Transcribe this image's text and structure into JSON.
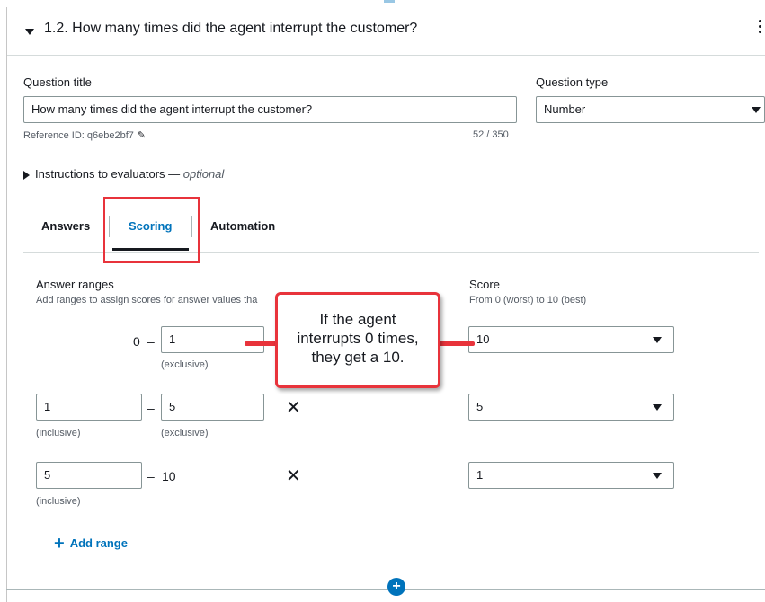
{
  "question": {
    "heading": "1.2. How many times did the agent interrupt the customer?",
    "title_label": "Question title",
    "title_value": "How many times did the agent interrupt the customer?",
    "reference_id": "Reference ID: q6ebe2bf7",
    "char_count": "52 / 350",
    "type_label": "Question type",
    "type_value": "Number"
  },
  "instructions": {
    "label": "Instructions to evaluators —",
    "optional": "optional"
  },
  "tabs": [
    {
      "label": "Answers"
    },
    {
      "label": "Scoring"
    },
    {
      "label": "Automation"
    }
  ],
  "scoring": {
    "ranges_title": "Answer ranges",
    "ranges_desc": "Add ranges to assign scores for answer values tha",
    "score_title": "Score",
    "score_desc": "From 0 (worst) to 10 (best)",
    "rows": [
      {
        "from_text": "0",
        "to_value": "1",
        "to_hint": "(exclusive)",
        "score": "10"
      },
      {
        "from_value": "1",
        "from_hint": "(inclusive)",
        "to_value": "5",
        "to_hint": "(exclusive)",
        "score": "5"
      },
      {
        "from_value": "5",
        "from_hint": "(inclusive)",
        "to_text": "10",
        "score": "1"
      }
    ],
    "dash": "–",
    "remove_symbol": "✕",
    "add_range": "Add range",
    "add_symbol": "+"
  },
  "callout": {
    "line1": "If the agent",
    "line2": "interrupts 0 times,",
    "line3": "they get a 10."
  },
  "colors": {
    "accent": "#0073bb",
    "annotation_red": "#e8333b",
    "text": "#16191f",
    "muted": "#545b64"
  }
}
